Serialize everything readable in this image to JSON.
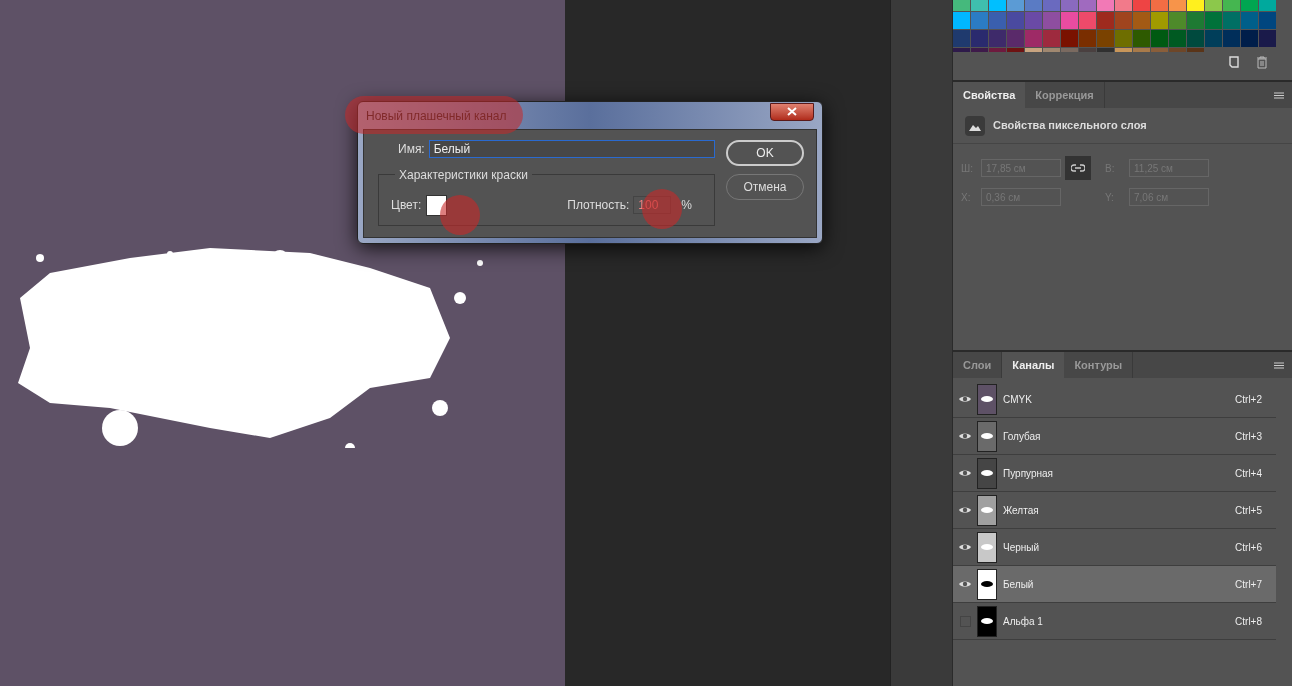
{
  "dialog": {
    "title": "Новый плашечный канал",
    "name_label": "Имя:",
    "name_value": "Белый",
    "group_title": "Характеристики краски",
    "color_label": "Цвет:",
    "color": "#ffffff",
    "density_label": "Плотность:",
    "density_value": "100",
    "density_unit": "%",
    "buttons": [
      {
        "label": "OK",
        "selected": true
      },
      {
        "label": "Отмена",
        "selected": false
      }
    ]
  },
  "properties_panel": {
    "tabs": [
      {
        "label": "Свойства",
        "selected": true
      },
      {
        "label": "Коррекция",
        "selected": false
      }
    ],
    "header": "Свойства пиксельного слоя",
    "fields": [
      {
        "label": "Ш:",
        "value": "17,85 см"
      },
      {
        "label": "В:",
        "value": "11,25 см"
      },
      {
        "label": "X:",
        "value": "0,36 см"
      },
      {
        "label": "Y:",
        "value": "7,06 см"
      }
    ]
  },
  "channels_panel": {
    "tabs": [
      {
        "label": "Слои",
        "selected": false
      },
      {
        "label": "Каналы",
        "selected": true
      },
      {
        "label": "Контуры",
        "selected": false
      }
    ],
    "channels": [
      {
        "name": "CMYK",
        "shortcut": "Ctrl+2",
        "visible": true,
        "selected": false,
        "color": "#5e5166"
      },
      {
        "name": "Голубая",
        "shortcut": "Ctrl+3",
        "visible": true,
        "selected": false,
        "color": "#6a6a6a"
      },
      {
        "name": "Пурпурная",
        "shortcut": "Ctrl+4",
        "visible": true,
        "selected": false,
        "color": "#454545"
      },
      {
        "name": "Желтая",
        "shortcut": "Ctrl+5",
        "visible": true,
        "selected": false,
        "color": "#a0a0a0"
      },
      {
        "name": "Черный",
        "shortcut": "Ctrl+6",
        "visible": true,
        "selected": false,
        "color": "#c8c8c8"
      },
      {
        "name": "Белый",
        "shortcut": "Ctrl+7",
        "visible": true,
        "selected": true,
        "color": "#ffffff"
      },
      {
        "name": "Альфа 1",
        "shortcut": "Ctrl+8",
        "visible": false,
        "selected": false,
        "color": "#000000"
      }
    ]
  }
}
